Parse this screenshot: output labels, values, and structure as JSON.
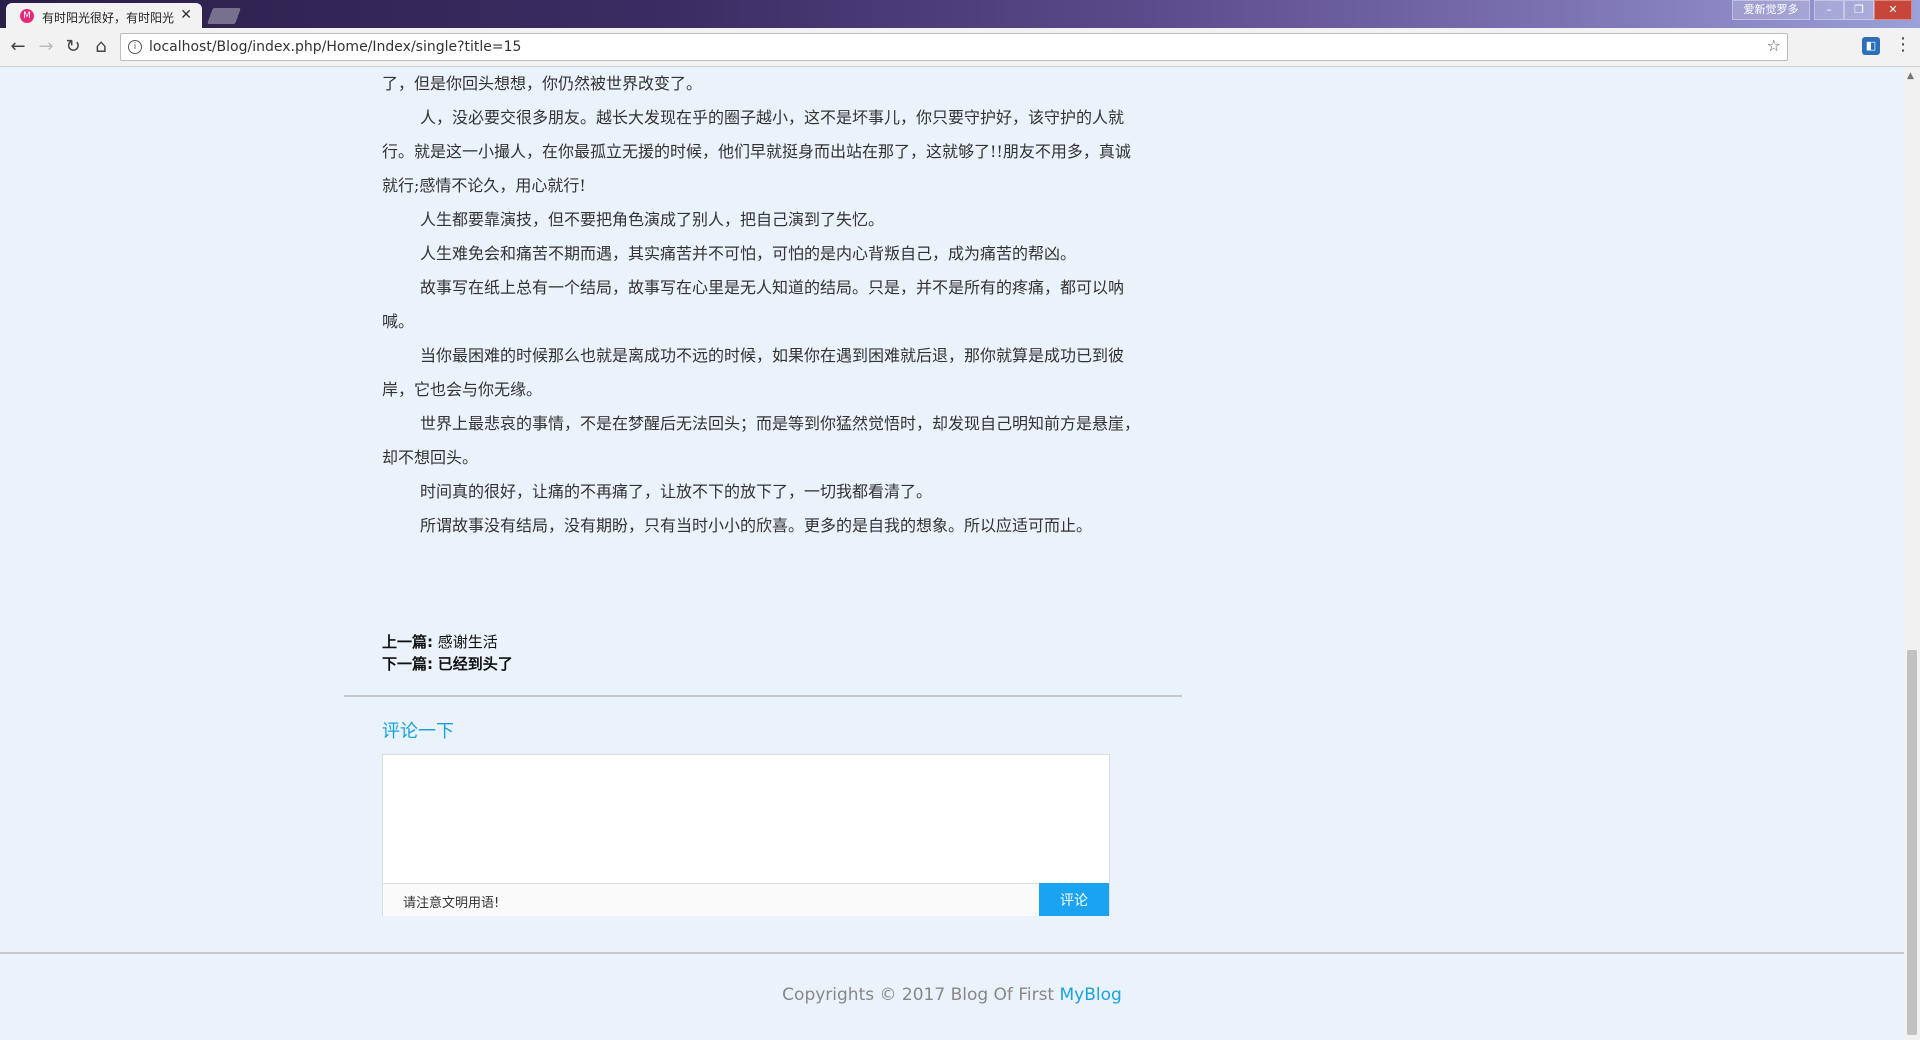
{
  "browser": {
    "active_tab_title": "有时阳光很好，有时阳光",
    "url": "localhost/Blog/index.php/Home/Index/single?title=15",
    "user_button": "爱新觉罗多",
    "controls": {
      "minimize": "–",
      "restore": "❐",
      "close": "✕"
    }
  },
  "article": {
    "paragraphs": [
      "了，但是你回头想想，你仍然被世界改变了。",
      "人，没必要交很多朋友。越长大发现在乎的圈子越小，这不是坏事儿，你只要守护好，该守护的人就行。就是这一小撮人，在你最孤立无援的时候，他们早就挺身而出站在那了，这就够了!!朋友不用多，真诚就行;感情不论久，用心就行!",
      "人生都要靠演技，但不要把角色演成了别人，把自己演到了失忆。",
      "人生难免会和痛苦不期而遇，其实痛苦并不可怕，可怕的是内心背叛自己，成为痛苦的帮凶。",
      "故事写在纸上总有一个结局，故事写在心里是无人知道的结局。只是，并不是所有的疼痛，都可以呐喊。",
      "当你最困难的时候那么也就是离成功不远的时候，如果你在遇到困难就后退，那你就算是成功已到彼岸，它也会与你无缘。",
      "世界上最悲哀的事情，不是在梦醒后无法回头；而是等到你猛然觉悟时，却发现自己明知前方是悬崖，却不想回头。",
      "时间真的很好，让痛的不再痛了，让放不下的放下了，一切我都看清了。",
      "所谓故事没有结局，没有期盼，只有当时小小的欣喜。更多的是自我的想象。所以应适可而止。"
    ],
    "prev_label": "上一篇:",
    "prev_title": "感谢生活",
    "next_label": "下一篇:",
    "next_title": "已经到头了"
  },
  "comment": {
    "title": "评论一下",
    "hint": "请注意文明用语!",
    "submit": "评论"
  },
  "footer": {
    "text": "Copyrights © 2017 Blog Of First",
    "link": "MyBlog"
  }
}
